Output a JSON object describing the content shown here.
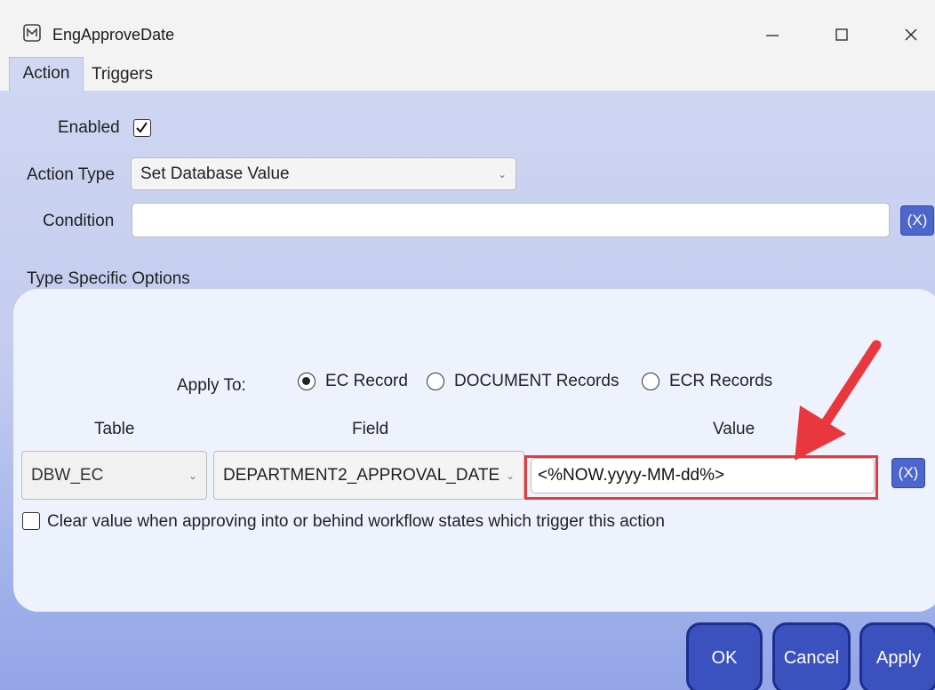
{
  "window": {
    "title": "EngApproveDate",
    "app_icon": "chain-m-icon",
    "controls": {
      "minimize": "—",
      "maximize": "☐",
      "close": "✕"
    }
  },
  "tabs": [
    {
      "label": "Action",
      "active": true
    },
    {
      "label": "Triggers",
      "active": false
    }
  ],
  "form": {
    "enabled_label": "Enabled",
    "enabled_checked": true,
    "action_type_label": "Action Type",
    "action_type_value": "Set Database Value",
    "condition_label": "Condition",
    "condition_value": "",
    "condition_x_button": "(X)",
    "type_specific_label": "Type Specific Options"
  },
  "apply_to": {
    "label": "Apply To:",
    "options": [
      {
        "label": "EC Record",
        "selected": true
      },
      {
        "label": "DOCUMENT Records",
        "selected": false
      },
      {
        "label": "ECR Records",
        "selected": false
      }
    ]
  },
  "columns": {
    "table": "Table",
    "field": "Field",
    "value": "Value"
  },
  "row": {
    "table": "DBW_EC",
    "field": "DEPARTMENT2_APPROVAL_DATE",
    "value": "<%NOW.yyyy-MM-dd%>",
    "x_button": "(X)"
  },
  "clear_option": {
    "label": "Clear value when approving into or behind workflow states which trigger this action",
    "checked": false
  },
  "buttons": {
    "ok": "OK",
    "cancel": "Cancel",
    "apply": "Apply"
  },
  "colors": {
    "accent": "#3a51be",
    "highlight": "#e8383d",
    "arrow": "#e8383d"
  }
}
